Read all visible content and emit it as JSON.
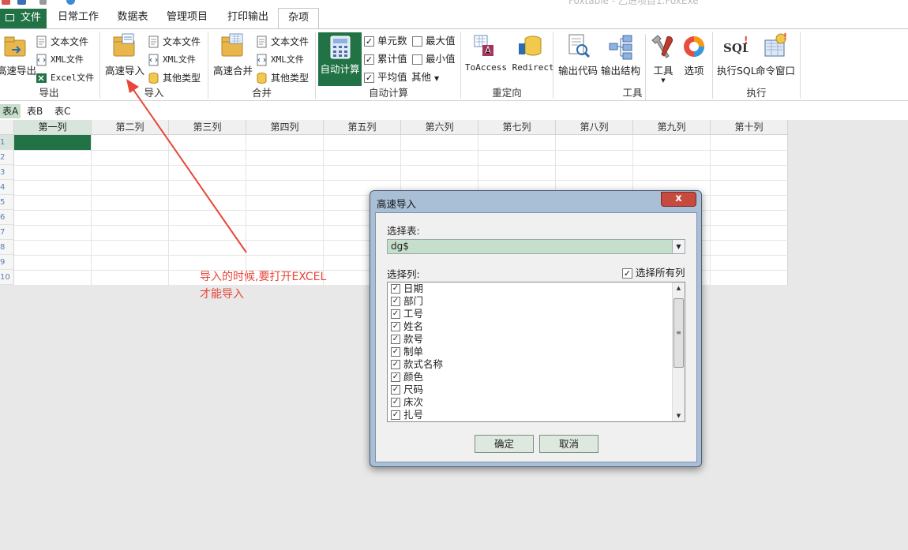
{
  "window": {
    "title": "Foxtable - 乙进项目1.FoxExe"
  },
  "ribbon_tabs": [
    "文件",
    "日常工作",
    "数据表",
    "管理项目",
    "打印输出",
    "杂项"
  ],
  "groups": {
    "export": {
      "label": "导出",
      "big": "高速导出",
      "items": [
        "文本文件",
        "XML文件",
        "Excel文件"
      ]
    },
    "import": {
      "label": "导入",
      "big": "高速导入",
      "items": [
        "文本文件",
        "XML文件",
        "其他类型"
      ]
    },
    "merge": {
      "label": "合并",
      "big": "高速合并",
      "items": [
        "文本文件",
        "XML文件",
        "其他类型"
      ]
    },
    "autocalc": {
      "label": "自动计算",
      "big": "自动计算",
      "checks": [
        {
          "label": "单元数",
          "checked": true
        },
        {
          "label": "最大值",
          "checked": false
        },
        {
          "label": "累计值",
          "checked": true
        },
        {
          "label": "最小值",
          "checked": false
        },
        {
          "label": "平均值",
          "checked": true
        }
      ],
      "other": "其他"
    },
    "redirect": {
      "label": "重定向",
      "big": "ToAccess Redirect"
    },
    "tools": {
      "label": "工具",
      "items": [
        "输出代码",
        "输出结构",
        "工具",
        "选项"
      ]
    },
    "exec": {
      "label": "执行",
      "items": [
        "执行SQL",
        "命令窗口"
      ]
    }
  },
  "sheets": [
    "表A",
    "表B",
    "表C"
  ],
  "columns": [
    "第一列",
    "第二列",
    "第三列",
    "第四列",
    "第五列",
    "第六列",
    "第七列",
    "第八列",
    "第九列",
    "第十列"
  ],
  "rows": [
    "1",
    "2",
    "3",
    "4",
    "5",
    "6",
    "7",
    "8",
    "9",
    "10"
  ],
  "annotation": [
    "导入的时候,要打开EXCEL",
    "才能导入"
  ],
  "dialog": {
    "title": "高速导入",
    "close": "x",
    "select_table_label": "选择表:",
    "table_value": "dg$",
    "select_columns_label": "选择列:",
    "select_all_label": "选择所有列",
    "select_all_checked": true,
    "columns": [
      "日期",
      "部门",
      "工号",
      "姓名",
      "款号",
      "制单",
      "款式名称",
      "颜色",
      "尺码",
      "床次",
      "扎号"
    ],
    "ok": "确定",
    "cancel": "取消"
  },
  "colors": {
    "accent": "#217346",
    "selection": "#c6dfcc",
    "annotation": "#e8463a",
    "dialog_frame": "#a9bfd6"
  }
}
